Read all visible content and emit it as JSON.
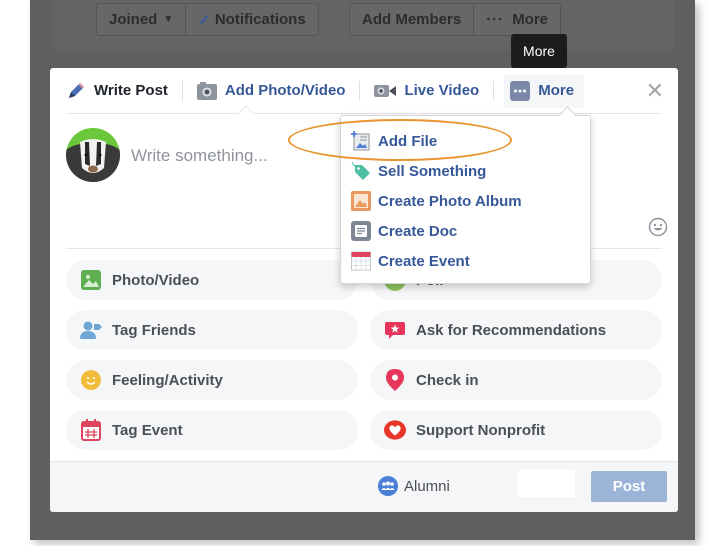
{
  "group_header": {
    "joined_label": "Joined",
    "notifications_label": "Notifications",
    "add_members_label": "Add Members",
    "more_label": "More"
  },
  "tooltip": {
    "text": "More"
  },
  "composer_tabs": [
    {
      "label": "Write Post",
      "icon": "pencil-icon"
    },
    {
      "label": "Add Photo/Video",
      "icon": "camera-icon"
    },
    {
      "label": "Live Video",
      "icon": "video-camera-icon"
    },
    {
      "label": "More",
      "icon": "more-dots-icon"
    }
  ],
  "composer": {
    "placeholder": "Write something...",
    "avatar_desc": "badger avatar"
  },
  "more_menu": [
    {
      "label": "Add File",
      "icon": "add-file-icon",
      "highlighted": true
    },
    {
      "label": "Sell Something",
      "icon": "price-tag-icon"
    },
    {
      "label": "Create Photo Album",
      "icon": "photo-album-icon"
    },
    {
      "label": "Create Doc",
      "icon": "doc-icon"
    },
    {
      "label": "Create Event",
      "icon": "calendar-icon"
    }
  ],
  "actions": [
    {
      "label": "Photo/Video",
      "icon": "photo-icon",
      "color": "#5fae52"
    },
    {
      "label": "Poll",
      "icon": "poll-icon",
      "color": "#8dc55e"
    },
    {
      "label": "Tag Friends",
      "icon": "tag-friends-icon",
      "color": "#6fa6d6"
    },
    {
      "label": "Ask for Recommendations",
      "icon": "recommendation-icon",
      "color": "#e7365c"
    },
    {
      "label": "Feeling/Activity",
      "icon": "smiley-icon",
      "color": "#f1bd3c"
    },
    {
      "label": "Check in",
      "icon": "location-pin-icon",
      "color": "#e7365c"
    },
    {
      "label": "Tag Event",
      "icon": "event-calendar-icon",
      "color": "#e0435d"
    },
    {
      "label": "Support Nonprofit",
      "icon": "nonprofit-heart-icon",
      "color": "#e9362a"
    }
  ],
  "footer": {
    "audience_label": "Alumni",
    "post_label": "Post"
  },
  "colors": {
    "link_blue": "#365899",
    "post_button": "#9cb4d8",
    "highlight_ring": "#e8952f",
    "overlay": "#5f5f61"
  }
}
